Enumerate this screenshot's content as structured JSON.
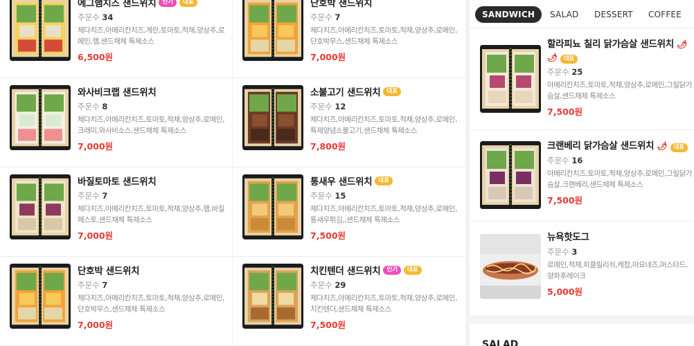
{
  "left_items": [
    {
      "name": "에그햄치즈 샌드위치",
      "badges": [
        {
          "label": "인기",
          "kind": "pop"
        },
        {
          "label": "대표",
          "kind": "rep"
        }
      ],
      "orders_label": "주문수",
      "orders": "34",
      "ingredients": "체다치즈,아메리칸치즈,계란,토마토,적채,양상추,로메인,햄,샌드채체 특제소스",
      "price": "6,500원",
      "fill": "egg"
    },
    {
      "name": "단호박 샌드위치",
      "badges": [],
      "orders_label": "주문수",
      "orders": "7",
      "ingredients": "체다치즈,아메리칸치즈,토마토,적채,양상추,로메인,단호박무스,샌드채체 특제소스",
      "price": "7,000원",
      "fill": "pumpkin"
    },
    {
      "name": "와사비크랩 샌드위치",
      "badges": [],
      "orders_label": "주문수",
      "orders": "8",
      "ingredients": "체다치즈,아메리칸치즈,토마토,적채,양상추,로메인,크래미,와사비소스,샌드채체 특제소스",
      "price": "7,000원",
      "fill": "crab"
    },
    {
      "name": "소불고기 샌드위치",
      "badges": [
        {
          "label": "대표",
          "kind": "rep"
        }
      ],
      "orders_label": "주문수",
      "orders": "12",
      "ingredients": "체다치즈,아메리칸치즈,토마토,적채,양상추,로메인,특제양념소불고기,샌드채체 특제소스",
      "price": "7,800원",
      "fill": "beef"
    },
    {
      "name": "바질토마토 샌드위치",
      "badges": [],
      "orders_label": "주문수",
      "orders": "7",
      "ingredients": "체다치즈,아메리칸치즈,토마토,적채,양상추,햄,바질페스토,샌드채체 특제소스",
      "price": "7,000원",
      "fill": "basil"
    },
    {
      "name": "통새우 샌드위치",
      "badges": [
        {
          "label": "대표",
          "kind": "rep"
        }
      ],
      "orders_label": "주문수",
      "orders": "15",
      "ingredients": "체다치즈,아메리칸치즈,토마토,적채,양상추,로메인,통새우튀김,,샌드채체 특제소스",
      "price": "7,500원",
      "fill": "shrimp"
    },
    {
      "name": "단호박 샌드위치",
      "badges": [],
      "orders_label": "주문수",
      "orders": "7",
      "ingredients": "체다치즈,아메리칸치즈,토마토,적채,양상추,로메인,단호박무스,샌드채체 특제소스",
      "price": "7,000원",
      "fill": "pumpkin"
    },
    {
      "name": "치킨텐더 샌드위치",
      "badges": [
        {
          "label": "인기",
          "kind": "pop"
        },
        {
          "label": "대표",
          "kind": "rep"
        }
      ],
      "orders_label": "주문수",
      "orders": "29",
      "ingredients": "체다치즈,아메리칸치즈,토마토,적채,양상추,로메인,치킨텐더,샌드채체 특제소스",
      "price": "7,500원",
      "fill": "chicken"
    }
  ],
  "tabs": [
    {
      "label": "SANDWICH",
      "active": true
    },
    {
      "label": "SALAD",
      "active": false
    },
    {
      "label": "DESSERT",
      "active": false
    },
    {
      "label": "COFFEE",
      "active": false
    }
  ],
  "right_items": [
    {
      "name": "할라피뇨 칠리 닭가슴살 샌드위치",
      "chili_count": 2,
      "badges": [
        {
          "label": "대표",
          "kind": "rep"
        }
      ],
      "orders_label": "주문수",
      "orders": "25",
      "ingredients": "아메리칸치즈,토마토,적채,양상추,로메인,그릴닭가슴살,샌드채체 특제소스",
      "price": "7,500원",
      "fill": "jalapeno"
    },
    {
      "name": "크랜베리 닭가슴살 샌드위치",
      "chili_count": 1,
      "badges": [
        {
          "label": "대표",
          "kind": "rep"
        }
      ],
      "orders_label": "주문수",
      "orders": "16",
      "ingredients": "아메리칸치즈,토마토,적채,양상추,로메인,그릴닭가슴살,크랜베리,샌드채체 특제소스",
      "price": "7,500원",
      "fill": "cranberry"
    },
    {
      "name": "뉴욕핫도그",
      "chili_count": 0,
      "badges": [],
      "orders_label": "주문수",
      "orders": "3",
      "ingredients": "로메인,적채,피클릴리쉬,케찹,마요네즈,머스타드,양파후레이크",
      "price": "5,000원",
      "fill": "hotdog"
    }
  ],
  "next_section": "SALAD",
  "chili_glyph": "🌶",
  "colors": {
    "price": "#e53935",
    "badge_popular": "#ee4fb8",
    "badge_representative": "#f7b733",
    "tab_active_bg": "#2a2a2a"
  }
}
